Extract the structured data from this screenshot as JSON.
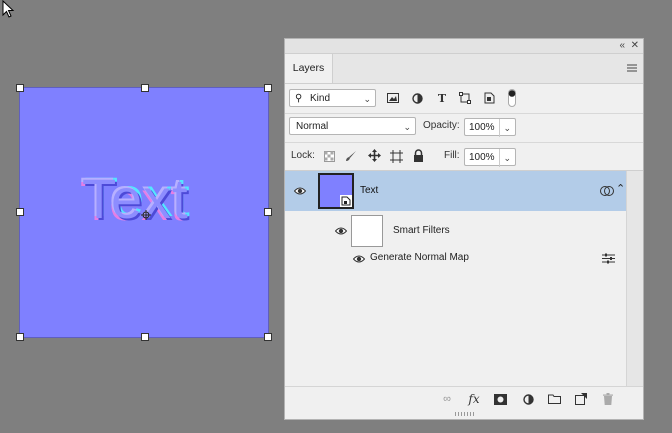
{
  "document": {
    "text": "Text"
  },
  "panel": {
    "tab": "Layers",
    "filter": {
      "kind_label": "Kind"
    },
    "blend_mode": "Normal",
    "opacity_label": "Opacity:",
    "opacity_value": "100%",
    "lock_label": "Lock:",
    "fill_label": "Fill:",
    "fill_value": "100%",
    "layers": [
      {
        "name": "Text",
        "selected": true
      },
      {
        "name": "Smart Filters"
      },
      {
        "name": "Generate Normal Map"
      }
    ],
    "icons": {
      "filter_types": [
        "image-filter-icon",
        "adjustment-filter-icon",
        "type-filter-icon",
        "shape-filter-icon",
        "smartobject-filter-icon",
        "filter-toggle-icon"
      ],
      "lock": [
        "lock-transparent-icon",
        "lock-image-icon",
        "lock-position-icon",
        "lock-artboard-icon",
        "lock-all-icon"
      ],
      "footer": [
        "link-layers-icon",
        "fx-icon",
        "add-mask-icon",
        "adjustment-layer-icon",
        "group-icon",
        "new-layer-icon",
        "delete-icon"
      ]
    },
    "colors": {
      "selected_row": "#b3cce8",
      "canvas": "#7f80ff"
    }
  }
}
